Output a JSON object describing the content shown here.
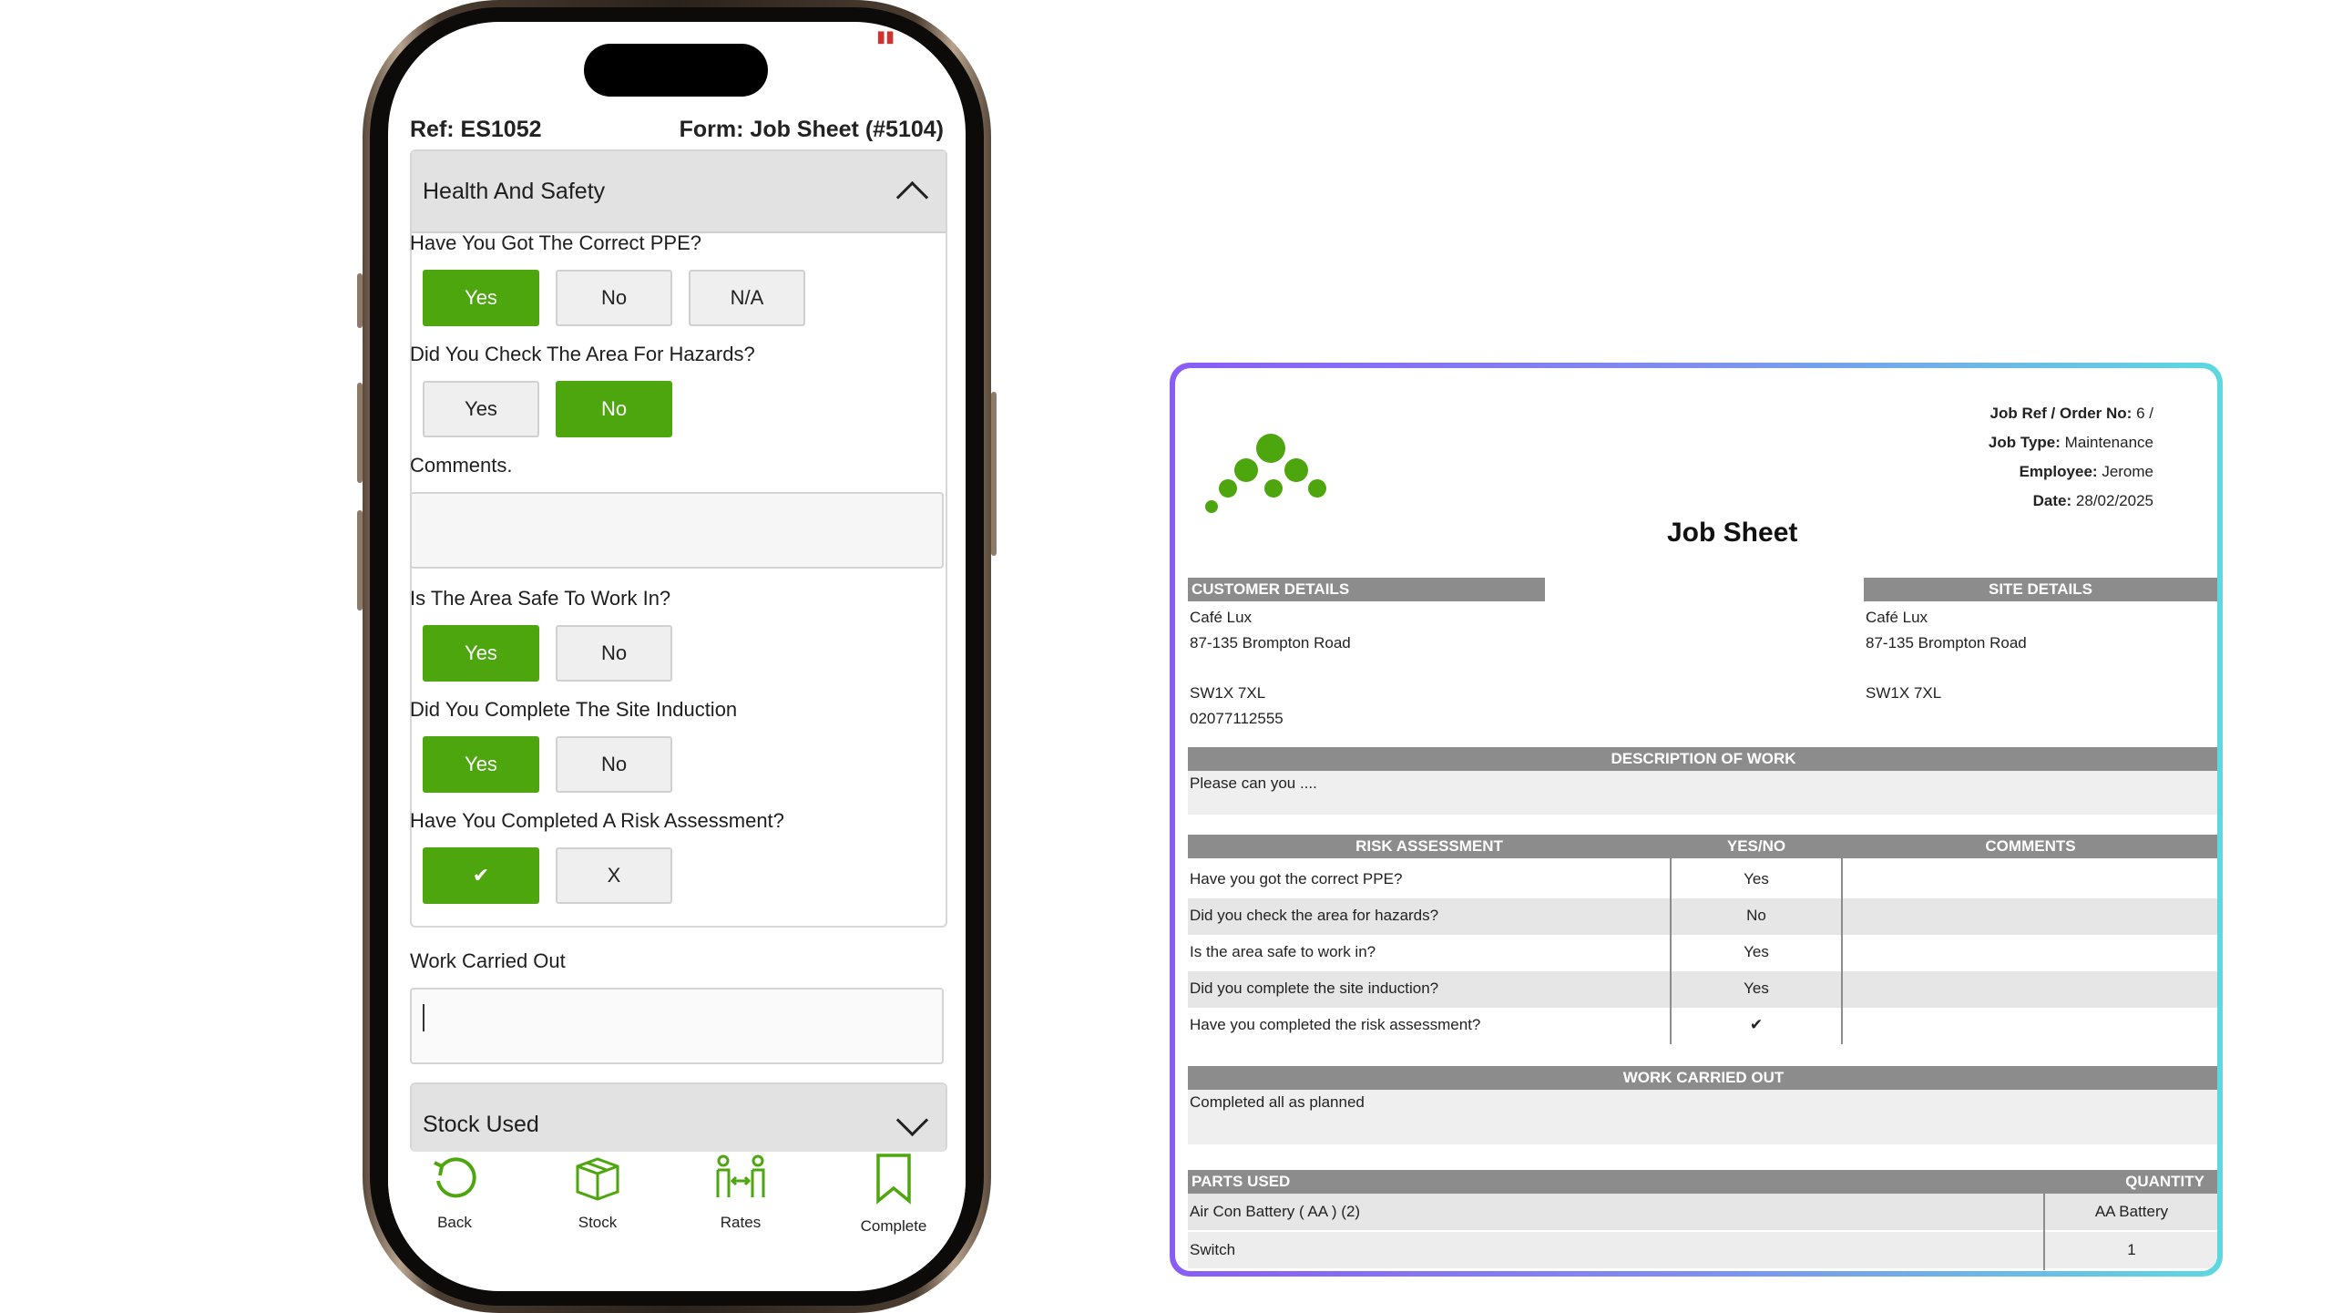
{
  "app": {
    "ref": "Ref: ES1052",
    "form": "Form: Job Sheet (#5104)"
  },
  "health_safety": {
    "title": "Health And Safety",
    "q1": "Have You Got The Correct PPE?",
    "q2": "Did You Check The Area For Hazards?",
    "comments_label": "Comments.",
    "q3": "Is The Area Safe To Work In?",
    "q4": "Did You Complete The Site Induction",
    "q5": "Have You Completed A Risk Assessment?",
    "opt_yes": "Yes",
    "opt_no": "No",
    "opt_na": "N/A",
    "opt_check": "✔",
    "opt_x": "X",
    "selected": {
      "q1": "Yes",
      "q2": "No",
      "q3": "Yes",
      "q4": "Yes",
      "q5": "✔"
    }
  },
  "work_carried_out_label": "Work Carried Out",
  "stock_used_title": "Stock Used",
  "nav": {
    "back": "Back",
    "stock": "Stock",
    "rates": "Rates",
    "complete": "Complete"
  },
  "accent_color": "#4ea60f",
  "doc": {
    "job_ref_label": "Job Ref / Order No:",
    "job_ref_value": "6 /",
    "job_type_label": "Job Type:",
    "job_type_value": "Maintenance",
    "employee_label": "Employee:",
    "employee_value": "Jerome",
    "date_label": "Date:",
    "date_value": "28/02/2025",
    "title": "Job Sheet",
    "customer_header": "CUSTOMER DETAILS",
    "site_header": "SITE DETAILS",
    "customer": {
      "name": "Café Lux",
      "address": "87-135 Brompton Road",
      "postcode": "SW1X 7XL",
      "phone": "02077112555"
    },
    "site": {
      "name": "Café Lux",
      "address": "87-135 Brompton Road",
      "postcode": "SW1X 7XL"
    },
    "description_header": "DESCRIPTION OF WORK",
    "description": "Please can you ....",
    "risk_headers": [
      "RISK ASSESSMENT",
      "YES/NO",
      "COMMENTS"
    ],
    "risk_rows": [
      {
        "q": "Have you got the correct PPE?",
        "a": "Yes"
      },
      {
        "q": "Did you check the area for hazards?",
        "a": "No"
      },
      {
        "q": "Is the area safe to work in?",
        "a": "Yes"
      },
      {
        "q": "Did you complete the site induction?",
        "a": "Yes"
      },
      {
        "q": "Have you completed the risk assessment?",
        "a": "✔"
      }
    ],
    "work_header": "WORK CARRIED OUT",
    "work_text": "Completed all as planned",
    "parts_header": "PARTS USED",
    "qty_header": "QUANTITY",
    "parts": [
      {
        "name": "Air Con Battery ( AA ) (2)",
        "qty": "AA Battery"
      },
      {
        "name": "Switch",
        "qty": "1"
      }
    ]
  }
}
